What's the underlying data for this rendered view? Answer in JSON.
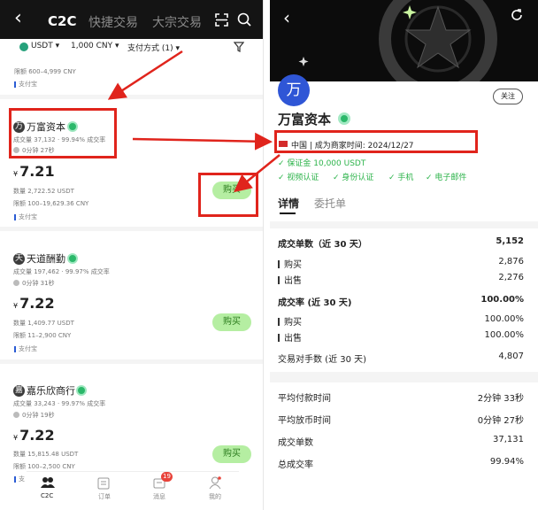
{
  "left": {
    "tabs": {
      "back": "‹",
      "c2c": "C2C",
      "quick": "快捷交易",
      "block": "大宗交易"
    },
    "filters": {
      "coin": "USDT ▾",
      "amount": "1,000 CNY ▾",
      "payment": "支付方式 (1) ▾"
    },
    "top_partial": {
      "limit": "限额 600–4,999 CNY",
      "pay": "支付宝"
    },
    "merchants": [
      {
        "name": "万富资本",
        "stats": "成交量 37,132 · 99.94% 成交率",
        "time": "0分钟 27秒",
        "price": "7.21",
        "ccy": "¥",
        "qty": "数量 2,722.52 USDT",
        "limit": "限额 100–19,629.36 CNY",
        "pay": "支付宝",
        "buy": "购买",
        "avatar": "万"
      },
      {
        "name": "天道酬勤",
        "stats": "成交量 197,462 · 99.97% 成交率",
        "time": "0分钟 31秒",
        "price": "7.22",
        "ccy": "¥",
        "qty": "数量 1,409.77 USDT",
        "limit": "限额 11–2,900 CNY",
        "pay": "支付宝",
        "buy": "购买",
        "avatar": "天"
      },
      {
        "name": "嘉乐欣商行",
        "stats": "成交量 33,243 · 99.97% 成交率",
        "time": "0分钟 19秒",
        "price": "7.22",
        "ccy": "¥",
        "qty": "数量 15,815.48 USDT",
        "limit": "限额 100–2,500 CNY",
        "pay": "支",
        "buy": "购买",
        "avatar": "嘉"
      }
    ],
    "bottom_nav": [
      {
        "label": "C2C"
      },
      {
        "label": "订单"
      },
      {
        "label": "消息",
        "badge": "19"
      },
      {
        "label": "我的"
      }
    ]
  },
  "right": {
    "follow": "关注",
    "avatar": "万",
    "name": "万富资本",
    "region": "中国 | 成为商家时间:  2024/12/27",
    "deposit": "✓ 保证金 10,000 USDT",
    "verifications": [
      "✓ 视频认证",
      "✓ 身份认证",
      "✓ 手机",
      "✓ 电子邮件"
    ],
    "tabs": {
      "details": "详情",
      "orders": "委托单"
    },
    "stats": {
      "orders_title": "成交单数（近 30 天）",
      "orders_value": "5,152",
      "buy_label": "购买",
      "buy_orders": "2,876",
      "sell_label": "出售",
      "sell_orders": "2,276",
      "rate_title": "成交率 (近 30 天)",
      "rate_value": "100.00%",
      "buy_rate": "100.00%",
      "sell_rate": "100.00%",
      "counterparties_label": "交易对手数 (近 30 天)",
      "counterparties_value": "4,807",
      "avg_pay_label": "平均付款时间",
      "avg_pay_value": "2分钟 33秒",
      "avg_release_label": "平均放币时间",
      "avg_release_value": "0分钟 27秒",
      "total_orders_label": "成交单数",
      "total_orders_value": "37,131",
      "total_rate_label": "总成交率",
      "total_rate_value": "99.94%"
    }
  },
  "colors": {
    "accent_green": "#2cb34a",
    "buy_button": "#b5eea2",
    "highlight_red": "#e0241c",
    "avatar_blue": "#2f56d6"
  }
}
